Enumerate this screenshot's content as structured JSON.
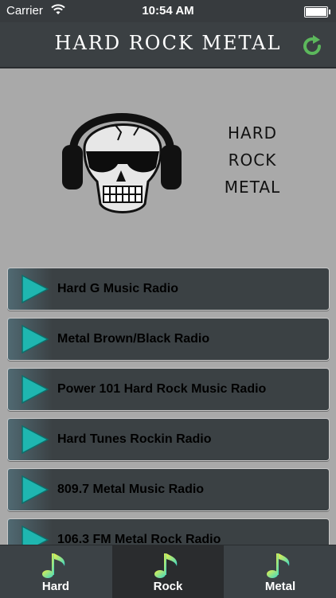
{
  "status_bar": {
    "carrier": "Carrier",
    "time": "10:54 AM"
  },
  "navbar": {
    "title": "HARD ROCK METAL",
    "refresh_icon": "refresh-icon"
  },
  "hero": {
    "line1": "HARD",
    "line2": "ROCK",
    "line3": "METAL"
  },
  "stations": [
    {
      "label": "Hard G Music Radio"
    },
    {
      "label": "Metal Brown/Black Radio"
    },
    {
      "label": "Power 101 Hard Rock Music Radio"
    },
    {
      "label": "Hard Tunes Rockin Radio"
    },
    {
      "label": "809.7 Metal Music Radio"
    },
    {
      "label": "106.3 FM Metal Rock Radio"
    }
  ],
  "tabs": [
    {
      "label": "Hard",
      "icon": "music-note-icon"
    },
    {
      "label": "Rock",
      "icon": "music-note-icon",
      "selected": true
    },
    {
      "label": "Metal",
      "icon": "music-note-icon"
    }
  ],
  "colors": {
    "accent_play": "#20b2aa",
    "nav_bg": "#3b4043",
    "page_bg": "#a9a9a9",
    "refresh": "#5cb85c"
  }
}
